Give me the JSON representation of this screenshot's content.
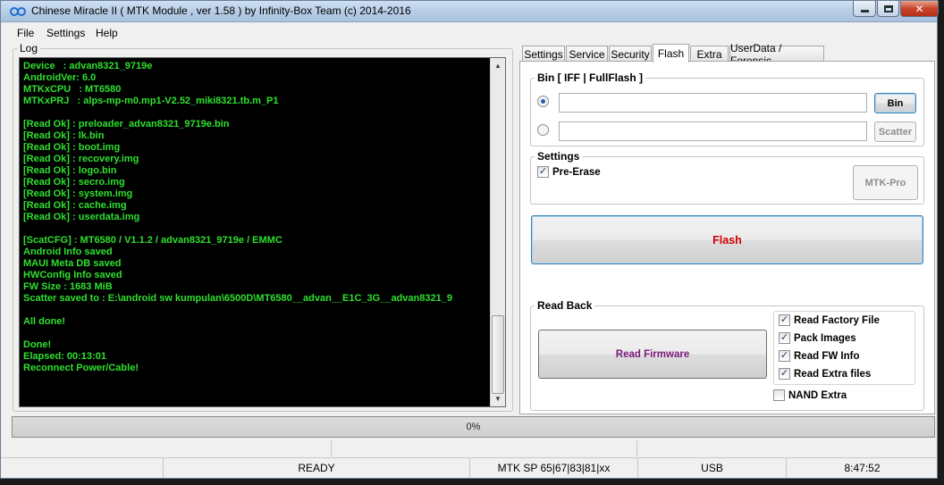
{
  "window": {
    "title": "Chinese Miracle II ( MTK Module , ver 1.58 ) by Infinity-Box Team (c) 2014-2016"
  },
  "menu": [
    "File",
    "Settings",
    "Help"
  ],
  "log": {
    "label": "Log",
    "lines": [
      "Device   : advan8321_9719e",
      "AndroidVer: 6.0",
      "MTKxCPU   : MT6580",
      "MTKxPRJ   : alps-mp-m0.mp1-V2.52_miki8321.tb.m_P1",
      "",
      "[Read Ok] : preloader_advan8321_9719e.bin",
      "[Read Ok] : lk.bin",
      "[Read Ok] : boot.img",
      "[Read Ok] : recovery.img",
      "[Read Ok] : logo.bin",
      "[Read Ok] : secro.img",
      "[Read Ok] : system.img",
      "[Read Ok] : cache.img",
      "[Read Ok] : userdata.img",
      "",
      "[ScatCFG] : MT6580 / V1.1.2 / advan8321_9719e / EMMC",
      "Android Info saved",
      "MAUI Meta DB saved",
      "HWConfig Info saved",
      "FW Size : 1683 MiB",
      "Scatter saved to : E:\\android sw kumpulan\\6500D\\MT6580__advan__E1C_3G__advan8321_9",
      "",
      "All done!",
      "",
      "Done!",
      "Elapsed: 00:13:01",
      "Reconnect Power/Cable!"
    ]
  },
  "tabs": [
    "Settings",
    "Service",
    "Security",
    "Flash",
    "Extra",
    "UserData / Forensic"
  ],
  "active_tab": "Flash",
  "flash": {
    "bin_group_label": "Bin  [ IFF | FullFlash ]",
    "bin_button": "Bin",
    "scatter_button": "Scatter",
    "bin_path": "",
    "scatter_path": "",
    "settings_label": "Settings",
    "pre_erase": {
      "label": "Pre-Erase",
      "checked": true
    },
    "mtk_pro_button": "MTK-Pro",
    "flash_button": "Flash",
    "readback_label": "Read Back",
    "read_firmware_button": "Read Firmware",
    "options": [
      {
        "label": "Read Factory File",
        "checked": true
      },
      {
        "label": "Pack Images",
        "checked": true
      },
      {
        "label": "Read FW Info",
        "checked": true
      },
      {
        "label": "Read Extra files",
        "checked": true
      }
    ],
    "nand_extra": {
      "label": "NAND Extra",
      "checked": false
    }
  },
  "progress": {
    "text": "0%",
    "value": 0
  },
  "status": {
    "state": "READY",
    "platform": "MTK SP 65|67|83|81|xx",
    "connection": "USB",
    "time": "8:47:52"
  },
  "colors": {
    "log_text": "#2ee02e",
    "flash_text": "#d10000",
    "read_firmware_text": "#7a1a7a"
  }
}
